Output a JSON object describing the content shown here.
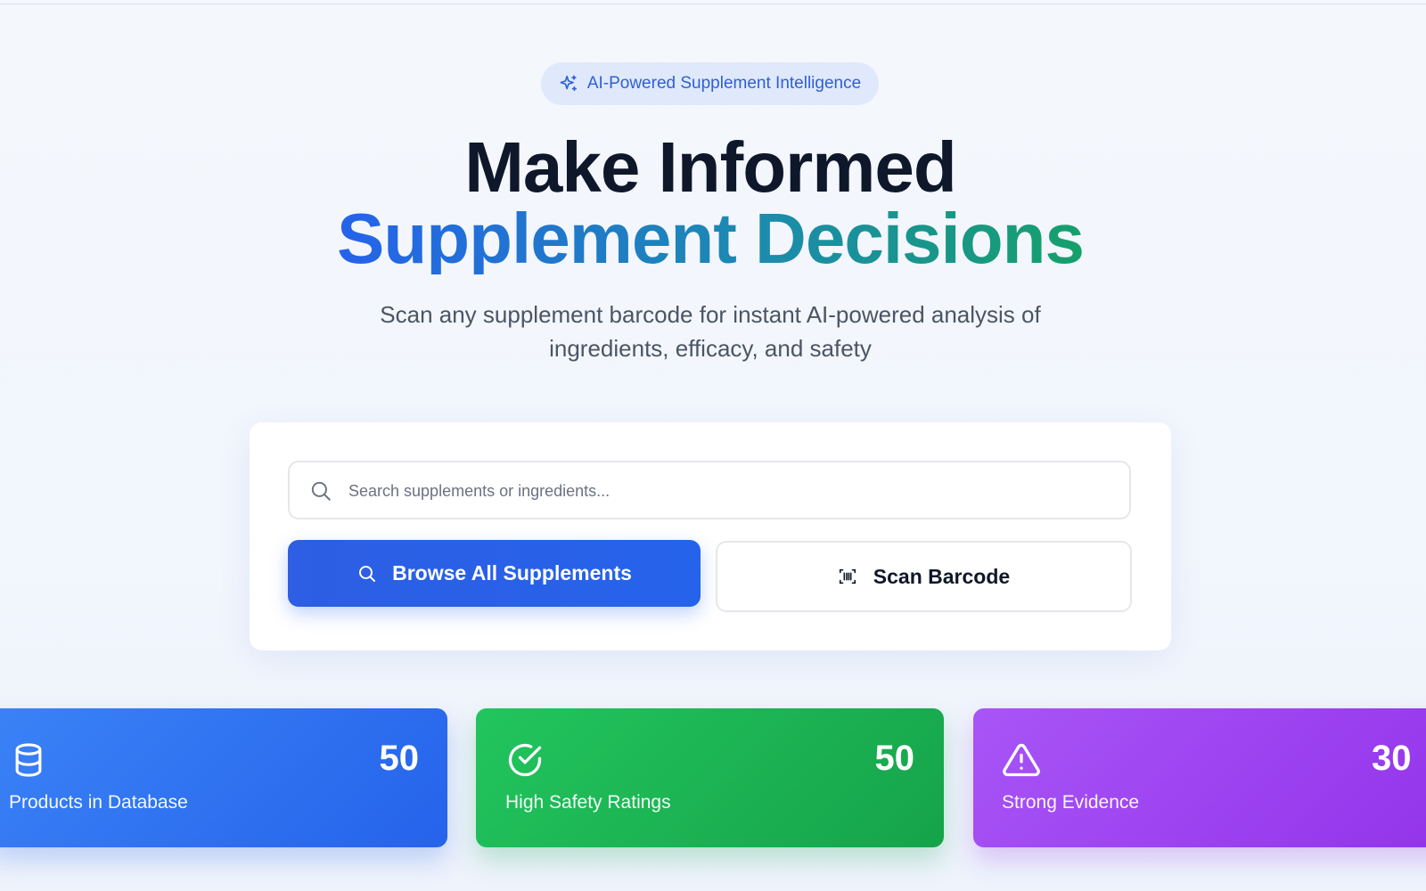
{
  "hero": {
    "badge_label": "AI-Powered Supplement Intelligence",
    "title_line1": "Make Informed",
    "title_line2": "Supplement Decisions",
    "subtitle": "Scan any supplement barcode for instant AI-powered analysis of ingredients, efficacy, and safety"
  },
  "search": {
    "placeholder": "Search supplements or ingredients...",
    "value": "",
    "icon": "search-icon"
  },
  "actions": {
    "browse_label": "Browse All Supplements",
    "browse_icon": "search-icon",
    "scan_label": "Scan Barcode",
    "scan_icon": "barcode-scan-icon"
  },
  "stats": [
    {
      "value": "50",
      "label": "Products in Database",
      "icon": "database-icon",
      "color": "#2563eb"
    },
    {
      "value": "50",
      "label": "High Safety Ratings",
      "icon": "check-circle-icon",
      "color": "#16a34a"
    },
    {
      "value": "30",
      "label": "Strong Evidence",
      "icon": "warning-triangle-icon",
      "color": "#9333ea"
    }
  ],
  "colors": {
    "primary": "#2563eb",
    "title_dark": "#0f172a",
    "gradient_end": "#16a06b",
    "badge_bg": "#dfe9fb"
  }
}
